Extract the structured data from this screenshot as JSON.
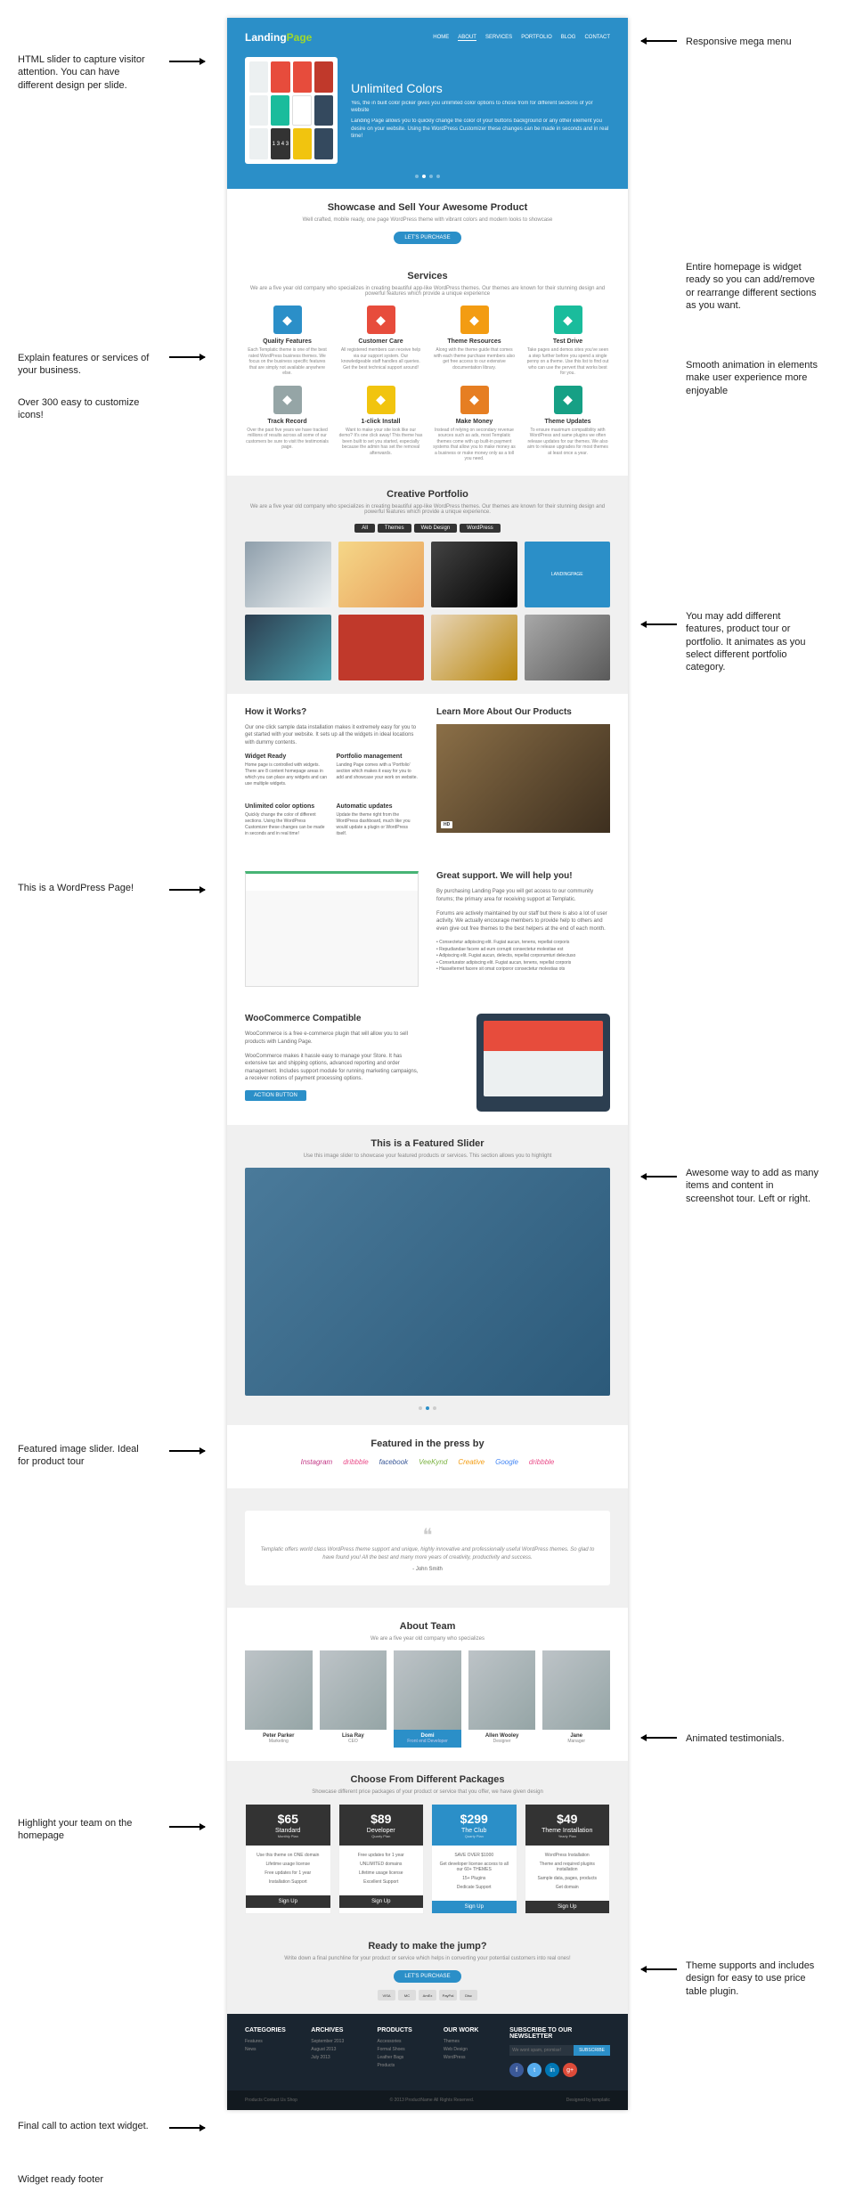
{
  "annotations": {
    "a1": "HTML slider to capture visitor attention. You can have different design per slide.",
    "a2": "Explain features or services of your business.",
    "a3": "Over 300 easy to customize icons!",
    "a4": "This is a WordPress Page!",
    "a5": "Featured image slider. Ideal for product tour",
    "a6": "Highlight your team on the homepage",
    "a7": "Final call to action text widget.",
    "a8": "Widget ready footer",
    "r1": "Responsive mega menu",
    "r2": "Entire homepage is widget ready so you can add/remove or rearrange different sections as you want.",
    "r3": "Smooth animation in elements make user experience more enjoyable",
    "r4": "You may add different features, product tour or portfolio. It animates as you select different portfolio category.",
    "r5": "Awesome way to add as many items and content in screenshot tour. Left or right.",
    "r6": "Animated testimonials.",
    "r7": "Theme supports and includes design for easy to use price table plugin."
  },
  "logo": {
    "part1": "Landing",
    "part2": "Page"
  },
  "menu": [
    "HOME",
    "ABOUT",
    "SERVICES",
    "PORTFOLIO",
    "BLOG",
    "CONTACT"
  ],
  "hero": {
    "title": "Unlimited Colors",
    "p1": "Yes, the in built color picker gives you unlimited color options to chose from for different sections of yor website",
    "p2": "Landing Page allows you to quickly change the color of your buttons background or any other element you desire on your website. Using the WordPress Customizer these changes can be made in seconds and in real time!"
  },
  "showcase": {
    "title": "Showcase and Sell Your Awesome Product",
    "sub": "Well crafted, mobile ready, one page WordPress theme with vibrant colors and modern looks to showcase",
    "btn": "LET'S PURCHASE"
  },
  "services": {
    "title": "Services",
    "sub": "We are a five year old company who specializes in creating beautiful app-like WordPress themes. Our themes are known for their stunning design and powerful features which provide a unique experience",
    "items": [
      {
        "title": "Quality Features",
        "desc": "Each Templatic theme is one of the best rated WordPress business themes. We focus on the business specific features that are simply not available anywhere else.",
        "color": "#2b8fc8"
      },
      {
        "title": "Customer Care",
        "desc": "All registered members can receive help via our support system. Our knowledgeable staff handles all queries. Get the best technical support around!",
        "color": "#e74c3c"
      },
      {
        "title": "Theme Resources",
        "desc": "Along with the theme guide that comes with each theme purchase members also get free access to our extensive documentation library.",
        "color": "#f39c12"
      },
      {
        "title": "Test Drive",
        "desc": "Take pages and demos sites you've seen a step further before you spend a single penny on a theme. Use this list to find out who can use the pervert that works best for you.",
        "color": "#1abc9c"
      },
      {
        "title": "Track Record",
        "desc": "Over the past five years we have tracked millions of results across all some of our customers be sure to visit the testimonials page.",
        "color": "#95a5a6"
      },
      {
        "title": "1-click Install",
        "desc": "Want to make your site look like our demo? It's one click away! This theme has been built to set you started, especially because the admin has set the removal afterwards.",
        "color": "#f1c40f"
      },
      {
        "title": "Make Money",
        "desc": "Instead of relying on secondary revenue sources such as ads, most Templatic themes come with up built-in payment systems that allow you to make money as a business or make money only as a toll you need.",
        "color": "#e67e22"
      },
      {
        "title": "Theme Updates",
        "desc": "To ensure maximum compatibility with WordPress and same plugins we often release updates for our themes. We also aim to release upgrades for most themes at least once a year.",
        "color": "#16a085"
      }
    ]
  },
  "portfolio": {
    "title": "Creative Portfolio",
    "sub": "We are a five year old company who specializes in creating beautiful app-like WordPress themes. Our themes are known for their stunning design and powerful features which provide a unique experience.",
    "filters": [
      "All",
      "Themes",
      "Web Design",
      "WordPress"
    ]
  },
  "how": {
    "title": "How it Works?",
    "intro": "Our one click sample data installation makes it extremely easy for you to get started with your website. It sets up all the widgets in ideal locations with dummy contents.",
    "cols": [
      {
        "title": "Widget Ready",
        "desc": "Home page is controlled with widgets. There are 8 content homepage areas in which you can place any widgets and can use multiple widgets."
      },
      {
        "title": "Portfolio management",
        "desc": "Landing Page comes with a 'Portfolio' section which makes it easy for you to add and showcase your work on website."
      },
      {
        "title": "Unlimited color options",
        "desc": "Quickly change the color of different sections. Using the WordPress Customizer these changes can be made in seconds and in real time!"
      },
      {
        "title": "Automatic updates",
        "desc": "Update the theme right from the WordPress dashboard, much like you would update a plugin or WordPress itself."
      }
    ]
  },
  "learn": {
    "title": "Learn More About Our Products"
  },
  "support": {
    "title": "Great support. We will help you!",
    "p1": "By purchasing Landing Page you will get access to our community forums; the primary area for receiving support at Templatic.",
    "p2": "Forums are actively maintained by our staff but there is also a lot of user activity. We actually encourage members to provide help to others and even give out free themes to the best helpers at the end of each month.",
    "bullets": [
      "Consectetur adipiscing elit. Fugiat aucun, tenens, repellat corporis",
      "Repudiandae facere ad eum corrupti consectetur molestiae est",
      "Adipiscing elit. Fugiat aucun, delectis, repellat corporumturi delectuso",
      "Conseturator adipiscing elit. Fugiat aucun, tenens, repellat corporis",
      "Hasselternet facere sit omat coriporor consectetur molestias ots"
    ]
  },
  "woo": {
    "title": "WooCommerce Compatible",
    "p1": "WooCommerce is a free e-commerce plugin that will allow you to sell products with Landing Page.",
    "p2": "WooCommerce makes it hassle easy to manage your Store. It has extensive tax and shipping options, advanced reporting and order management. Includes support module for running marketing campaigns, a receiver notions of payment processing options.",
    "btn": "ACTION BUTTON"
  },
  "featured": {
    "title": "This is a Featured Slider",
    "sub": "Use this image slider to showcase your featured products or services. This section allows you to highlight"
  },
  "press": {
    "title": "Featured in the press by",
    "logos": [
      "Instagram",
      "dribbble",
      "facebook",
      "VeeKynd",
      "Creative",
      "Google",
      "dribbble"
    ]
  },
  "testimonial": {
    "text": "Templatic offers world class WordPress theme support and unique, highly innovative and professionally useful WordPress themes. So glad to have found you! All the best and many more years of creativity, productivity and success.",
    "author": "- John Smith"
  },
  "team": {
    "title": "About Team",
    "sub": "We are a five year old company who specializes",
    "members": [
      {
        "name": "Peter Parker",
        "role": "Marketing"
      },
      {
        "name": "Lisa Ray",
        "role": "CEO"
      },
      {
        "name": "Domi",
        "role": "Front end Developer"
      },
      {
        "name": "Allen Wooley",
        "role": "Designer"
      },
      {
        "name": "Jane",
        "role": "Manager"
      }
    ]
  },
  "pricing": {
    "title": "Choose From Different Packages",
    "sub": "Showcase different price packages of your product or service that you offer, we have given design",
    "plans": [
      {
        "price": "$65",
        "name": "Standard",
        "sub": "Monthly Plan",
        "features": [
          "Use this theme on ONE domain",
          "Lifetime usage license",
          "Free updates for 1 year",
          "Installation Support"
        ],
        "btn": "Sign Up"
      },
      {
        "price": "$89",
        "name": "Developer",
        "sub": "Quarty Plan",
        "features": [
          "Free updates for 1 year",
          "UNLIMITED domains",
          "Lifetime usage license",
          "Excellent Support"
        ],
        "btn": "Sign Up"
      },
      {
        "price": "$299",
        "name": "The Club",
        "sub": "Quarty Plan",
        "features": [
          "SAVE OVER $1000",
          "Get developer license access to all our 60+ THEMES",
          "15+ Plugins",
          "Dedicate Support"
        ],
        "btn": "Sign Up"
      },
      {
        "price": "$49",
        "name": "Theme Installation",
        "sub": "Yearly Plan",
        "features": [
          "WordPress Installation",
          "Theme and required plugins installation",
          "Sample data, pages, products",
          "Get domain"
        ],
        "btn": "Sign Up"
      }
    ]
  },
  "cta": {
    "title": "Ready to make the jump?",
    "sub": "Write down a final punchline for your product or service which helps in converting your potential customers into real ones!",
    "btn": "LET'S PURCHASE"
  },
  "footer": {
    "cols": [
      {
        "title": "CATEGORIES",
        "links": [
          "Features",
          "News"
        ]
      },
      {
        "title": "ARCHIVES",
        "links": [
          "September 2013",
          "August 2013",
          "July 2013"
        ]
      },
      {
        "title": "PRODUCTS",
        "links": [
          "Accessories",
          "Formal Shoes",
          "Leather Bags",
          "Products"
        ]
      },
      {
        "title": "OUR WORK",
        "links": [
          "Themes",
          "Web Design",
          "WordPress"
        ]
      }
    ],
    "newsletter": {
      "title": "SUBSCRIBE TO OUR NEWSLETTER",
      "placeholder": "We wont spam, promise!",
      "btn": "SUBSCRIBE"
    },
    "bottom": {
      "left": "© 2013 ProductName All Rights Reserved.",
      "links": "Products  Contact Us  Shop",
      "right": "Designed by templatic"
    }
  }
}
